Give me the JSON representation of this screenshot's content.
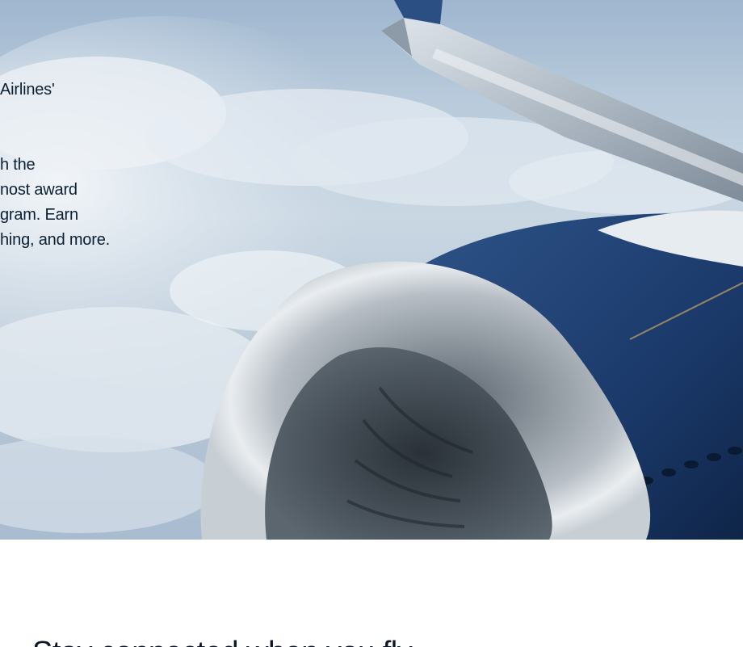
{
  "hero": {
    "intro_lines": [
      "Airlines'"
    ],
    "body_lines": [
      "h the",
      "nost award",
      "gram. Earn",
      "hing, and more."
    ],
    "image": "aircraft-wing-and-engine-above-clouds",
    "colors": {
      "sky": "#b8cadb",
      "engine_blue": "#1b3a6b",
      "text": "#0c1f33"
    }
  },
  "section": {
    "heading": "Stay connected when you fly"
  }
}
